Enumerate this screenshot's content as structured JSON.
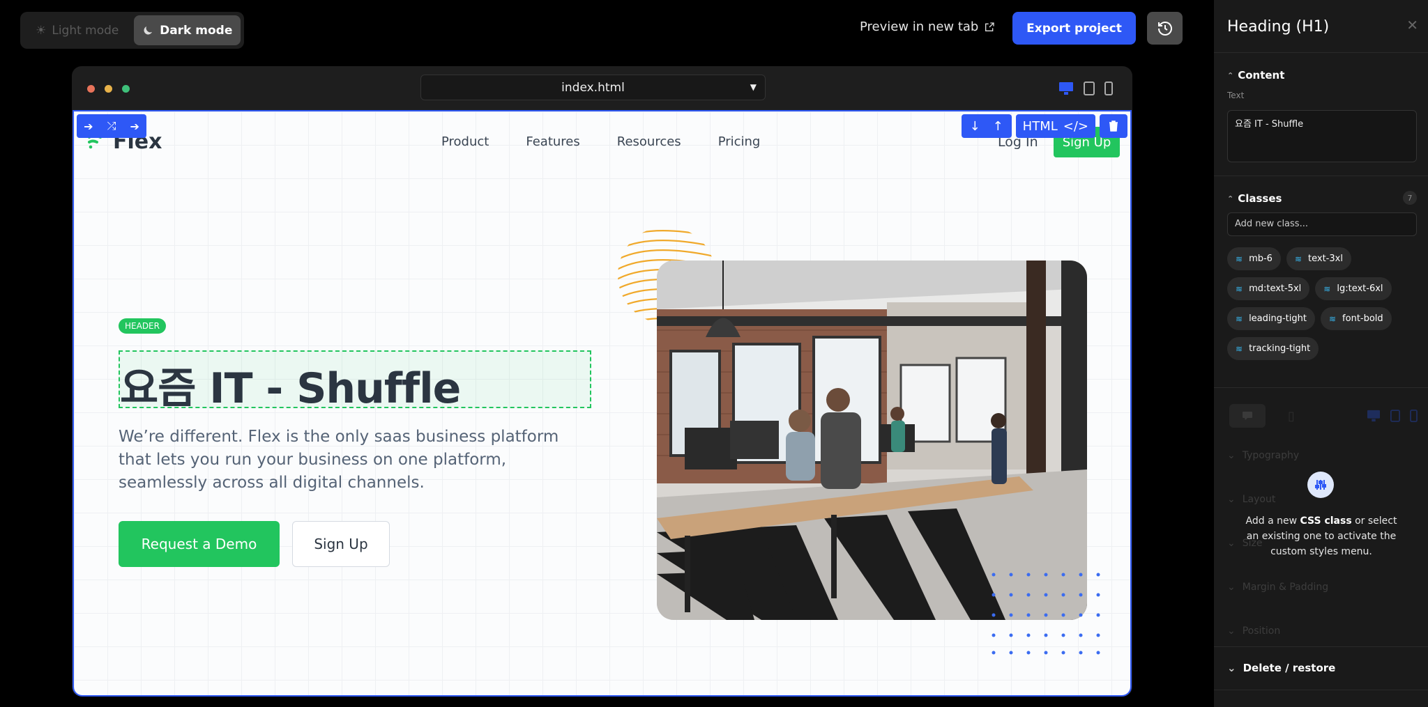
{
  "topbar": {
    "light_mode": "Light mode",
    "dark_mode": "Dark mode",
    "preview": "Preview in new tab",
    "export": "Export project"
  },
  "browser": {
    "file": "index.html"
  },
  "site": {
    "logo": "Flex",
    "nav": [
      "Product",
      "Features",
      "Resources",
      "Pricing"
    ],
    "login": "Log In",
    "signup": "Sign Up",
    "badge": "HEADER",
    "headline": "요즘 IT - Shuffle",
    "lead": "We’re different. Flex is the only saas business platform that lets you run your business on one platform, seamlessly across all digital channels.",
    "cta_primary": "Request a Demo",
    "cta_secondary": "Sign Up"
  },
  "editor_toolbar": {
    "html_label": "HTML"
  },
  "panel": {
    "title": "Heading (H1)",
    "content_label": "Content",
    "text_label": "Text",
    "text_value": "요즘 IT - Shuffle",
    "classes_label": "Classes",
    "classes_count": "7",
    "add_class_placeholder": "Add new class...",
    "classes": [
      "mb-6",
      "text-3xl",
      "md:text-5xl",
      "lg:text-6xl",
      "leading-tight",
      "font-bold",
      "tracking-tight"
    ],
    "sections": [
      "Typography",
      "Layout",
      "Size",
      "Margin & Padding",
      "Position"
    ],
    "overlay_pre": "Add a new",
    "overlay_bold": "CSS class",
    "overlay_post": "or select an existing one to activate the custom styles menu.",
    "delete_restore": "Delete / restore"
  },
  "colors": {
    "accent": "#2e58f6",
    "green": "#22c55e",
    "panel_bg": "#1a1a1a"
  }
}
